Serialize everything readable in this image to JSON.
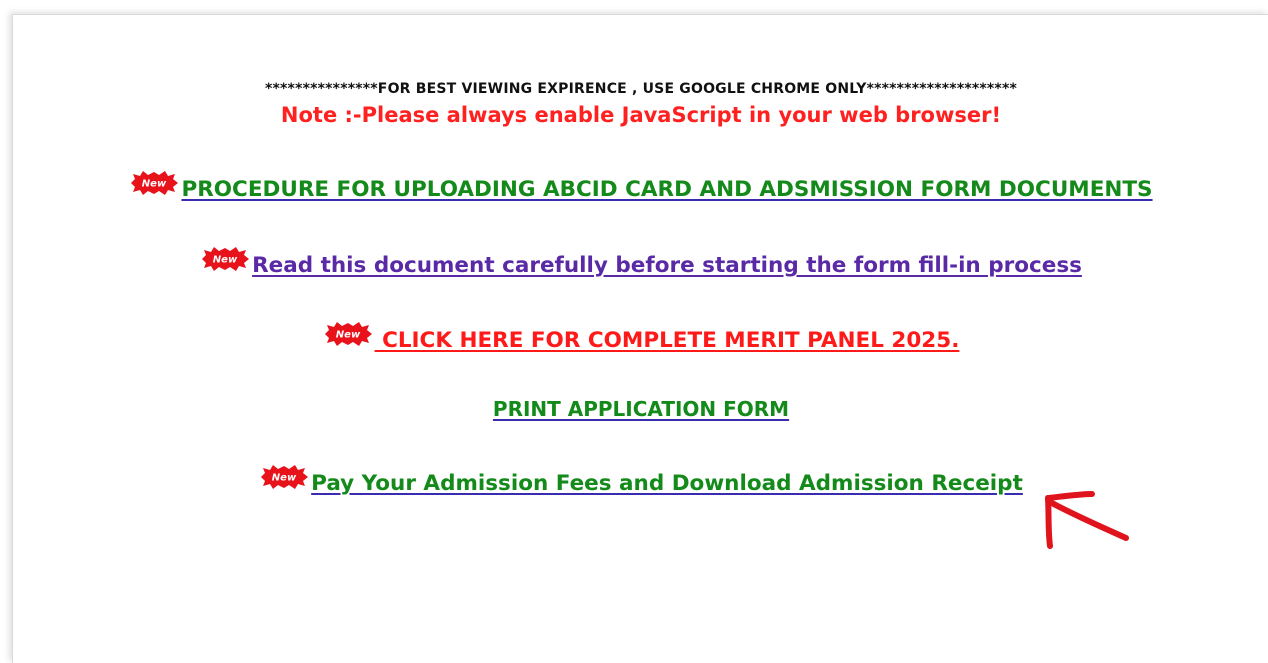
{
  "notices": {
    "browser_warning": "***************FOR BEST VIEWING EXPIRENCE , USE GOOGLE CHROME ONLY********************",
    "javascript_note": "Note :-Please always enable JavaScript in your web browser!"
  },
  "links": {
    "procedure_upload": "PROCEDURE FOR UPLOADING ABCID CARD AND ADSMISSION FORM DOCUMENTS",
    "read_document": "Read this document carefully before starting the form fill-in process",
    "merit_panel": " CLICK HERE FOR COMPLETE MERIT PANEL 2025.",
    "print_application": "PRINT APPLICATION FORM",
    "pay_fees": "Pay Your Admission Fees and Download Admission Receipt"
  },
  "badges": {
    "new_label": "New"
  },
  "icons": {
    "new_badge": "new-burst-icon",
    "annotation_arrow": "red-arrow-annotation"
  },
  "colors": {
    "warning_text": "#111111",
    "note_red": "#ff2020",
    "link_green": "#138a1a",
    "link_purple": "#5a2aa6",
    "link_red": "#ff1a1a",
    "badge_red": "#e8121b",
    "arrow_red": "#e0141c"
  }
}
